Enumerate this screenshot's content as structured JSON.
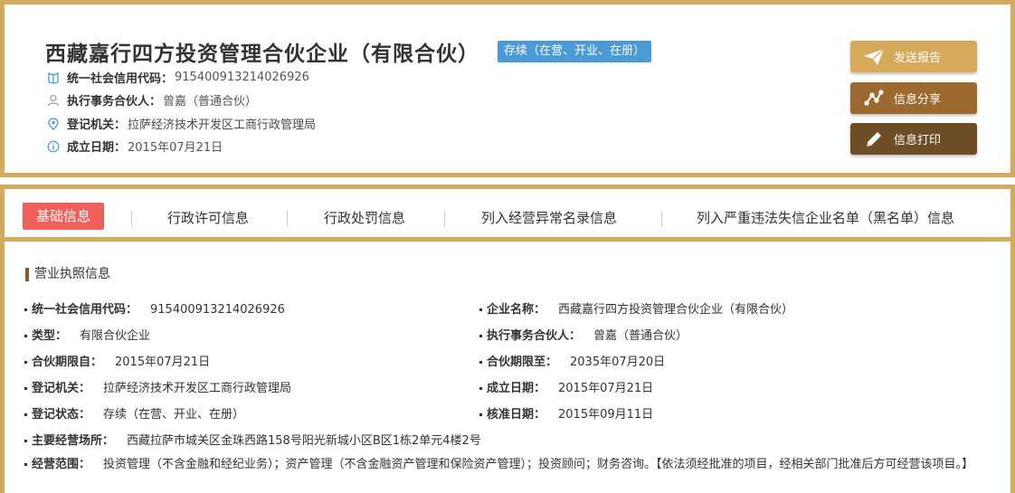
{
  "company": {
    "name": "西藏嘉行四方投资管理合伙企业（有限合伙）",
    "status": "存续（在营、开业、在册）",
    "credit_code_label": "统一社会信用代码：",
    "credit_code": "915400913214026926",
    "partner_label": "执行事务合伙人：",
    "partner": "曾嘉（普通合伙）",
    "authority_label": "登记机关：",
    "authority": "拉萨经济技术开发区工商行政管理局",
    "founded_label": "成立日期：",
    "founded": "2015年07月21日"
  },
  "actions": {
    "report": "发送报告",
    "share": "信息分享",
    "print": "信息打印"
  },
  "tabs": [
    {
      "label": "基础信息",
      "active": true
    },
    {
      "label": "行政许可信息"
    },
    {
      "label": "行政处罚信息"
    },
    {
      "label": "列入经营异常名录信息"
    },
    {
      "label": "列入严重违法失信企业名单（黑名单）信息"
    }
  ],
  "license": {
    "section_title": "营业执照信息",
    "fields": [
      {
        "label": "统一社会信用代码：",
        "value": "915400913214026926"
      },
      {
        "label": "企业名称：",
        "value": "西藏嘉行四方投资管理合伙企业（有限合伙）"
      },
      {
        "label": "类型：",
        "value": "有限合伙企业"
      },
      {
        "label": "执行事务合伙人：",
        "value": "曾嘉（普通合伙）"
      },
      {
        "label": "合伙期限自：",
        "value": "2015年07月21日"
      },
      {
        "label": "合伙期限至：",
        "value": "2035年07月20日"
      },
      {
        "label": "登记机关：",
        "value": "拉萨经济技术开发区工商行政管理局"
      },
      {
        "label": "成立日期：",
        "value": "2015年07月21日"
      },
      {
        "label": "登记状态：",
        "value": "存续（在营、开业、在册）"
      },
      {
        "label": "核准日期：",
        "value": "2015年09月11日"
      },
      {
        "label": "主要经营场所：",
        "value": "西藏拉萨市城关区金珠西路158号阳光新城小区B区1栋2单元4楼2号"
      },
      {
        "label": "经营范围：",
        "value": "投资管理（不含金融和经纪业务）；资产管理（不含金融资产管理和保险资产管理）；投资顾问；财务咨询。【依法须经批准的项目，经相关部门批准后方可经营该项目。】"
      }
    ]
  },
  "colors": {
    "border_gold": "#d2ab5f",
    "status_blue": "#4a9ad8",
    "tab_active": "#f0605a",
    "btn_report": "#d7a95a",
    "btn_share": "#9c6a2e",
    "btn_print": "#6e4e24"
  }
}
